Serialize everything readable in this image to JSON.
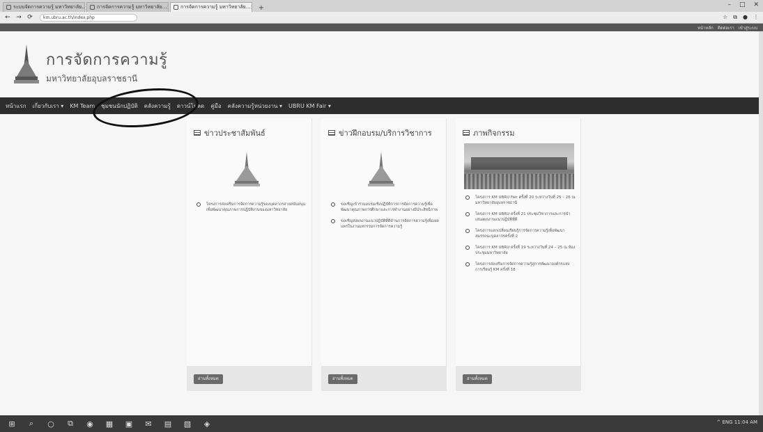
{
  "browser": {
    "tabs": [
      {
        "title": "ระบบจัดการความรู้ มหาวิทยาลัย..."
      },
      {
        "title": "การจัดการความรู้ มหาวิทยาลัย..."
      },
      {
        "title": "การจัดการความรู้ มหาวิทยาลัย..."
      }
    ],
    "new_tab": "+",
    "url": "km.ubru.ac.th/index.php",
    "window_controls": [
      "–",
      "□",
      "✕"
    ],
    "nav": {
      "back": "←",
      "forward": "→",
      "reload": "⟳"
    }
  },
  "top_links": [
    "หน้าหลัก",
    "ติดต่อเรา",
    "เข้าสู่ระบบ"
  ],
  "site": {
    "title": "การจัดการความรู้",
    "subtitle": "มหาวิทยาลัยอุบลราชธานี"
  },
  "nav": {
    "items": [
      "หน้าแรก",
      "เกี่ยวกับเรา ▾",
      "KM Team",
      "ชุมชนนักปฏิบัติ",
      "คลังความรู้",
      "ดาวน์โหลด",
      "คู่มือ",
      "คลังความรู้หน่วยงาน ▾",
      "UBRU KM Fair ▾"
    ]
  },
  "cards": [
    {
      "title": "ข่าวประชาสัมพันธ์",
      "items": [
        "โครงการส่งเสริมการจัดการความรู้ของบุคลากรสายสนับสนุนเพื่อพัฒนาคุณภาพการปฏิบัติงานของมหาวิทยาลัย"
      ],
      "more": "อ่านทั้งหมด"
    },
    {
      "title": "ข่าวฝึกอบรม/บริการวิชาการ",
      "items": [
        "ขอเชิญเข้าร่วมอบรมเชิงปฏิบัติการการจัดการความรู้เพื่อพัฒนาคุณภาพการศึกษาและการทำงานอย่างมีประสิทธิภาพ",
        "ขอเชิญส่งผลงานแนวปฏิบัติที่ดีด้านการจัดการความรู้เพื่อเผยแพร่ในงานมหกรรมการจัดการความรู้"
      ],
      "more": "อ่านทั้งหมด"
    },
    {
      "title": "ภาพกิจกรรม",
      "items": [
        "โครงการ KM UBRU Fair ครั้งที่ 20 ระหว่างวันที่ 25 – 26 ณ มหาวิทยาลัยอุบลราชธานี",
        "โครงการ KM UBRU ครั้งที่ 21 ประชุมวิชาการและการนำเสนอผลงานแนวปฏิบัติที่ดี",
        "โครงการแลกเปลี่ยนเรียนรู้การจัดการความรู้เพื่อพัฒนาสมรรถนะบุคลากรครั้งที่ 2",
        "โครงการ KM UBRU ครั้งที่ 19 ระหว่างวันที่ 24 – 25 ณ ห้องประชุมมหาวิทยาลัย",
        "โครงการส่งเสริมการจัดการความรู้สู่การพัฒนาองค์กรแห่งการเรียนรู้ KM ครั้งที่ 18"
      ],
      "more": "อ่านทั้งหมด"
    }
  ],
  "taskbar": {
    "icons": [
      "⊞",
      "⌕",
      "○",
      "⧉",
      "◉",
      "▦",
      "▣",
      "✉",
      "▤",
      "▧",
      "◈"
    ],
    "tray": "^ ENG 11:04 AM"
  }
}
